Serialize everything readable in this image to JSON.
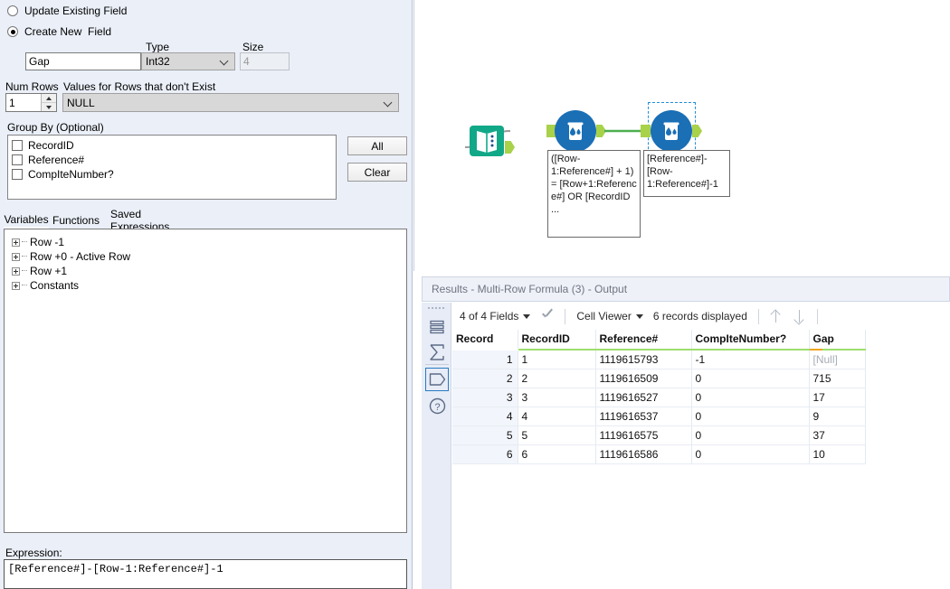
{
  "config": {
    "mode_options": [
      {
        "label": "Update Existing Field",
        "selected": false
      },
      {
        "label": "Create New  Field",
        "selected": true
      }
    ],
    "field_name_label": "",
    "field_name_value": "Gap",
    "type_label": "Type",
    "type_value": "Int32",
    "size_label": "Size",
    "size_value": "4",
    "num_rows_label": "Num Rows",
    "num_rows_value": "1",
    "values_missing_label": "Values for Rows that don't Exist",
    "values_missing_value": "NULL",
    "group_by_label": "Group By (Optional)",
    "group_by_items": [
      {
        "label": "RecordID",
        "checked": false
      },
      {
        "label": "Reference#",
        "checked": false
      },
      {
        "label": "CompIteNumber?",
        "checked": false
      }
    ],
    "all_button": "All",
    "clear_button": "Clear",
    "tabs": [
      {
        "label": "Variables",
        "active": true
      },
      {
        "label": "Functions",
        "active": false
      },
      {
        "label": "Saved Expressions",
        "active": false
      }
    ],
    "variables_tree": [
      {
        "label": "Row -1"
      },
      {
        "label": "Row +0 - Active Row"
      },
      {
        "label": "Row +1"
      },
      {
        "label": "Constants"
      }
    ],
    "expression_label": "Expression:",
    "expression_value": "[Reference#]-[Row-1:Reference#]-1"
  },
  "canvas": {
    "tools": [
      {
        "name": "text-input-tool",
        "icon": "book-icon",
        "color": "#11a888"
      },
      {
        "name": "multi-row-formula-tool-1",
        "icon": "beaker-icon",
        "color": "#1a6fb5",
        "annotation": "([Row-1:Reference#] + 1) = [Row+1:Referenc e#] OR [RecordID   ..."
      },
      {
        "name": "multi-row-formula-tool-2",
        "icon": "beaker-icon",
        "color": "#1a6fb5",
        "annotation": "[Reference#]-[Row-1:Reference#]-1",
        "selected": true
      }
    ],
    "connection_color": "#4caf50"
  },
  "results": {
    "title": "Results - Multi-Row Formula (3) - Output",
    "sidebar_icons": [
      "data-table-icon",
      "profile-sigma-icon",
      "metadata-tag-icon",
      "help-question-icon"
    ],
    "toolbar": {
      "fields_label": "4 of 4 Fields",
      "viewer_label": "Cell Viewer",
      "records_label": "6 records displayed"
    },
    "columns": [
      "Record",
      "RecordID",
      "Reference#",
      "CompIteNumber?",
      "Gap"
    ],
    "rows": [
      {
        "Record": "1",
        "RecordID": "1",
        "Reference#": "1119615793",
        "CompIteNumber?": "-1",
        "Gap": "[Null]",
        "gap_null": true
      },
      {
        "Record": "2",
        "RecordID": "2",
        "Reference#": "1119616509",
        "CompIteNumber?": "0",
        "Gap": "715",
        "gap_null": false
      },
      {
        "Record": "3",
        "RecordID": "3",
        "Reference#": "1119616527",
        "CompIteNumber?": "0",
        "Gap": "17",
        "gap_null": false
      },
      {
        "Record": "4",
        "RecordID": "4",
        "Reference#": "1119616537",
        "CompIteNumber?": "0",
        "Gap": "9",
        "gap_null": false
      },
      {
        "Record": "5",
        "RecordID": "5",
        "Reference#": "1119616575",
        "CompIteNumber?": "0",
        "Gap": "37",
        "gap_null": false
      },
      {
        "Record": "6",
        "RecordID": "6",
        "Reference#": "1119616586",
        "CompIteNumber?": "0",
        "Gap": "10",
        "gap_null": false
      }
    ]
  }
}
